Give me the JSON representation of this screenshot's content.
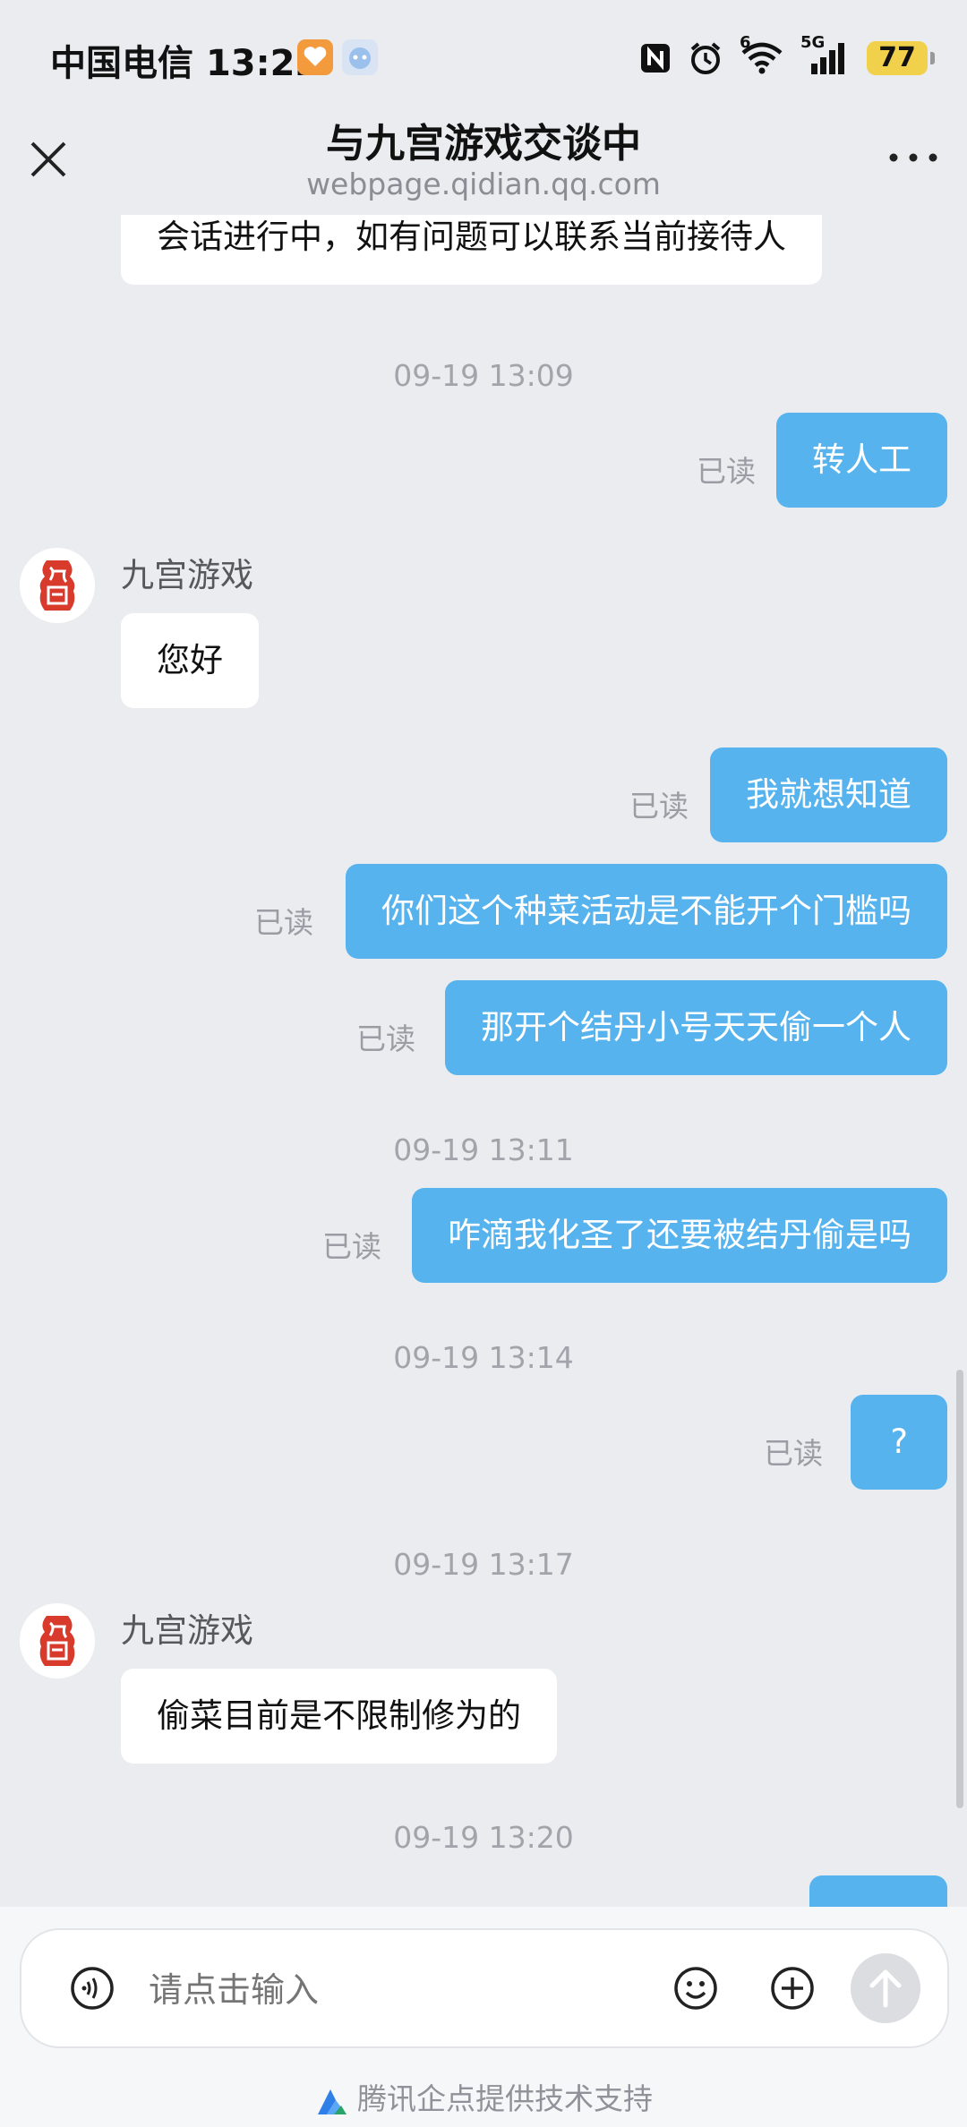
{
  "status_bar": {
    "carrier": "中国电信",
    "time": "13:22",
    "network": "5G",
    "wifi_label": "6",
    "battery": "77"
  },
  "header": {
    "title": "与九宫游戏交谈中",
    "subtitle": "webpage.qidian.qq.com"
  },
  "chat": {
    "partial_message": "会话进行中，如有问题可以联系当前接待人",
    "read_label": "已读",
    "sender_name": "九宫游戏",
    "timestamps": [
      "09-19 13:09",
      "09-19 13:11",
      "09-19 13:14",
      "09-19 13:17",
      "09-19 13:20"
    ],
    "messages": [
      {
        "dir": "out",
        "text": "转人工"
      },
      {
        "dir": "in",
        "text": "您好"
      },
      {
        "dir": "out",
        "text": "我就想知道"
      },
      {
        "dir": "out",
        "text": "你们这个种菜活动是不能开个门槛吗"
      },
      {
        "dir": "out",
        "text": "那开个结丹小号天天偷一个人"
      },
      {
        "dir": "out",
        "text": "咋滴我化圣了还要被结丹偷是吗"
      },
      {
        "dir": "out",
        "text": "?"
      },
      {
        "dir": "in",
        "text": "偷菜目前是不限制修为的"
      }
    ]
  },
  "input": {
    "placeholder": "请点击输入"
  },
  "footer": {
    "text": "腾讯企点提供技术支持"
  },
  "colors": {
    "background": "#ebecf0",
    "outgoing_bubble": "#56b3ee",
    "incoming_bubble": "#ffffff",
    "avatar_red": "#d83a2c"
  }
}
